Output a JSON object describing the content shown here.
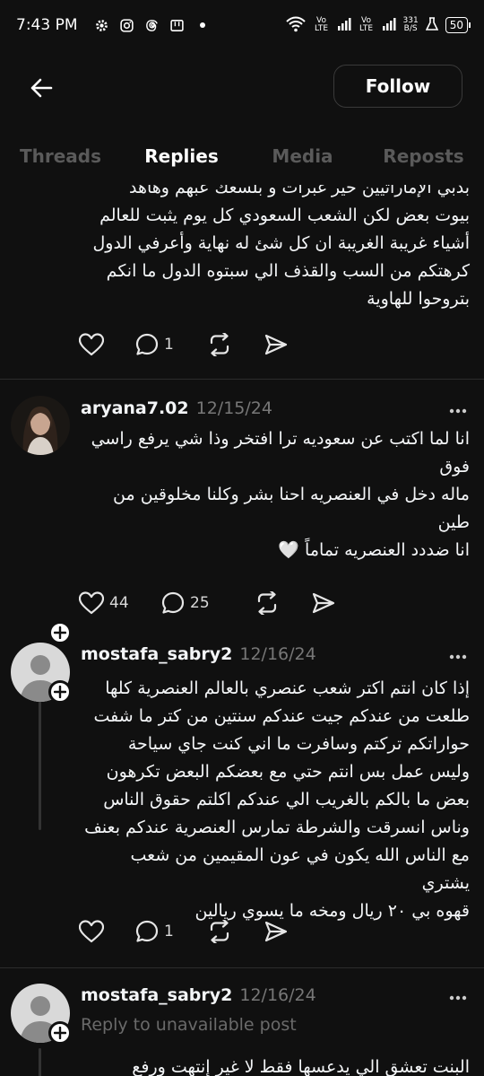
{
  "status_bar": {
    "time": "7:43 PM",
    "icons": [
      "gear-icon",
      "instagram-icon",
      "threads-icon",
      "wallet-icon",
      "dot-icon"
    ],
    "net_speed_top": "331",
    "net_speed_bottom": "B/S",
    "lte1": "Vo LTE",
    "lte2": "Vo LTE",
    "battery": "50"
  },
  "header": {
    "follow_label": "Follow"
  },
  "tabs": [
    {
      "label": "Threads",
      "active": false
    },
    {
      "label": "Replies",
      "active": true
    },
    {
      "label": "Media",
      "active": false
    },
    {
      "label": "Reposts",
      "active": false
    }
  ],
  "posts": [
    {
      "lines": [
        "بدبي الإماراتيين خير غبرات و بلسعك عبهم وهاهد",
        "بيوت بعض لكن الشعب السعودي كل يوم يثبت للعالم",
        "أشياء غريبة الغريبة ان كل شئ له نهاية وأعرفي الدول",
        "كرهتكم من السب والقذف الي سبتوه الدول ما انكم",
        "بتروحوا للهاوية"
      ],
      "likes": "",
      "replies": "1",
      "reposts": "",
      "shares": ""
    },
    {
      "username": "aryana7.02",
      "timestamp": "12/15/24",
      "lines": [
        "انا لما اكتب عن سعوديه ترا افتخر وذا شي يرفع راسي",
        "فوق",
        "ماله دخل في العنصريه احنا بشر وكلنا مخلوقين من",
        "طين",
        "انا ضددد العنصريه تماماً 🤍"
      ],
      "likes": "44",
      "replies": "25"
    },
    {
      "username": "mostafa_sabry2",
      "timestamp": "12/16/24",
      "lines": [
        "إذا كان انتم اكتر شعب عنصري بالعالم العنصرية كلها",
        "طلعت من عندكم جيت عندكم سنتين من كتر ما شفت",
        "حواراتكم تركتم وسافرت ما اني كنت جاي سياحة",
        "وليس عمل بس انتم حتي مع بعضكم البعض تكرهون",
        "بعض ما بالكم بالغريب الي عندكم اكلتم حقوق الناس",
        "وناس انسرقت والشرطة تمارس العنصرية عندكم بعنف",
        "مع الناس الله يكون في عون المقيمين من شعب يشتري",
        "قهوه بي ٢٠ ريال ومخه ما يسوي ريالين"
      ],
      "likes": "",
      "replies": "1"
    },
    {
      "username": "mostafa_sabry2",
      "timestamp": "12/16/24",
      "reply_note": "Reply to unavailable post",
      "lines": [
        "البنت تعشق الي يدعسها فقط لا غير إنتهت ورفع"
      ]
    }
  ]
}
